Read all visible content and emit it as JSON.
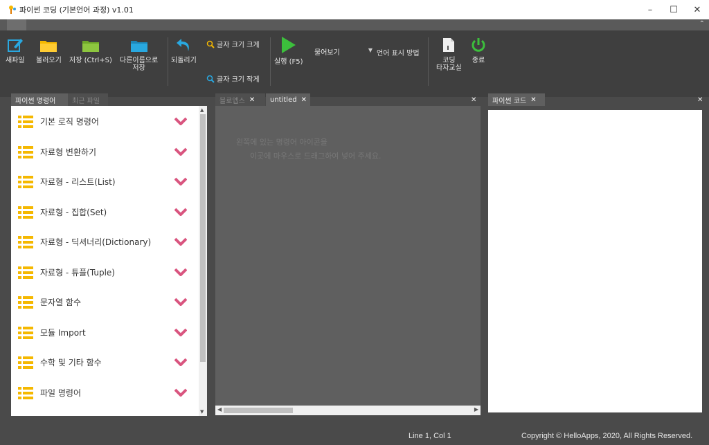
{
  "window": {
    "title": "파이썬 코딩 (기본언어 과정) v1.01"
  },
  "toolbar": {
    "new_file": "새파일",
    "open": "불러오기",
    "save": "저장 (Ctrl+S)",
    "save_as_line1": "다른이름으로",
    "save_as_line2": "저장",
    "undo": "되돌리기",
    "font_bigger": "글자 크기 크게",
    "font_smaller": "글자 크기 작게",
    "run": "실행 (F5)",
    "view_mode_value": "물어보기",
    "view_mode_label": "언어 표시 방법",
    "typing_line1": "코딩",
    "typing_line2": "타자교실",
    "exit": "종료"
  },
  "left_panel": {
    "tab_commands": "파이썬 명령어",
    "tab_recent": "최근 파일",
    "items": [
      {
        "label": "기본 로직 명령어"
      },
      {
        "label": "자료형 변환하기"
      },
      {
        "label": "자료형 - 리스트(List)"
      },
      {
        "label": "자료형 - 집합(Set)"
      },
      {
        "label": "자료형 - 딕셔너리(Dictionary)"
      },
      {
        "label": "자료형 - 튜플(Tuple)"
      },
      {
        "label": "문자열 함수"
      },
      {
        "label": "모듈 Import"
      },
      {
        "label": "수학 및 기타 함수"
      },
      {
        "label": "파일 명령어"
      }
    ]
  },
  "editor": {
    "tab_blocks": "블로엡스",
    "tab_untitled": "untitled",
    "hint_line1": "왼쪽에 있는 명령어 아이콘을",
    "hint_line2": "이곳에 마우스로 드래그하여 넣어 주세요."
  },
  "code_panel": {
    "tab": "파이썬 코드"
  },
  "status": {
    "position": "Line 1, Col 1",
    "copyright": "Copyright © HelloApps, 2020, All Rights Reserved."
  },
  "colors": {
    "chevron": "#d9557f",
    "list_icon": "#f5b800",
    "folder": "#f5b800",
    "save_folder": "#8dc63f",
    "saveas_folder": "#29a8e0",
    "run": "#3cbf3c",
    "power": "#3cbf3c"
  }
}
